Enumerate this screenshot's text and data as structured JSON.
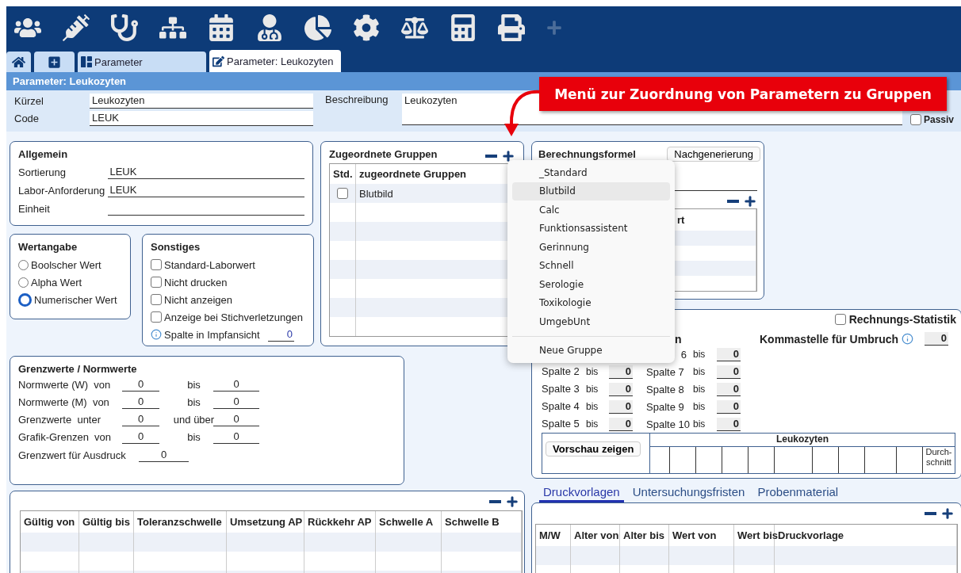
{
  "tabs": [
    {
      "label": "Parameter",
      "kind": "list",
      "selected": false
    },
    {
      "label": "Parameter: Leukozyten",
      "kind": "edit",
      "selected": true
    }
  ],
  "page_title": "Parameter: Leukozyten",
  "header_form": {
    "kuerzel": {
      "label": "Kürzel",
      "value": "Leukozyten"
    },
    "code": {
      "label": "Code",
      "value": "LEUK"
    },
    "beschreibung": {
      "label": "Beschreibung",
      "value": "Leukozyten"
    },
    "passiv": {
      "label": "Passiv",
      "checked": false
    }
  },
  "callout": {
    "text": "Menü zur Zuordnung von Parametern zu Gruppen"
  },
  "allgemein": {
    "title": "Allgemein",
    "fields": [
      {
        "label": "Sortierung",
        "value": "LEUK"
      },
      {
        "label": "Labor-Anforderung",
        "value": "LEUK"
      },
      {
        "label": "Einheit"
      }
    ]
  },
  "wertangabe": {
    "title": "Wertangabe",
    "options": [
      {
        "label": "Boolscher Wert",
        "selected": false
      },
      {
        "label": "Alpha Wert",
        "selected": false
      },
      {
        "label": "Numerischer Wert",
        "selected": true
      }
    ]
  },
  "sonstiges": {
    "title": "Sonstiges",
    "checkboxes": [
      {
        "label": "Standard-Laborwert",
        "checked": false
      },
      {
        "label": "Nicht drucken",
        "checked": false
      },
      {
        "label": "Nicht anzeigen",
        "checked": false
      },
      {
        "label": "Anzeige bei Stichverletzungen",
        "checked": false
      }
    ],
    "impf": {
      "label": "Spalte in Impfansicht",
      "value": "0"
    }
  },
  "gruppen": {
    "title": "Zugeordnete Gruppen",
    "columns": [
      "Std.",
      "zugeordnete Gruppen"
    ],
    "rows": [
      {
        "std": false,
        "name": "Blutbild"
      }
    ]
  },
  "menu": {
    "items": [
      {
        "label": "_Standard",
        "selected": false
      },
      {
        "label": "Blutbild",
        "selected": true
      },
      {
        "label": "Calc",
        "selected": false
      },
      {
        "label": "Funktionsassistent",
        "selected": false
      },
      {
        "label": "Gerinnung",
        "selected": false
      },
      {
        "label": "Schnell",
        "selected": false
      },
      {
        "label": "Serologie",
        "selected": false
      },
      {
        "label": "Toxikologie",
        "selected": false
      },
      {
        "label": "UmgebUnt",
        "selected": false
      }
    ],
    "footer": "Neue Gruppe"
  },
  "formel": {
    "title": "Berechnungsformel",
    "button": "Nachgenerierung",
    "list_header": "rt"
  },
  "statistik": {
    "heading": "n",
    "checkbox": {
      "label": "Rechnungs-Statistik",
      "checked": false
    },
    "komma": {
      "label": "Kommastelle für Umbruch",
      "value": "0"
    },
    "left": [
      {
        "label": "Spalte 2",
        "bis": "bis",
        "value": "0"
      },
      {
        "label": "Spalte 3",
        "bis": "bis",
        "value": "0"
      },
      {
        "label": "Spalte 4",
        "bis": "bis",
        "value": "0"
      },
      {
        "label": "Spalte 5",
        "bis": "bis",
        "value": "0"
      }
    ],
    "right": [
      {
        "label": "6",
        "bis": "bis",
        "value": "0"
      },
      {
        "label": "Spalte 7",
        "bis": "bis",
        "value": "0"
      },
      {
        "label": "Spalte 8",
        "bis": "bis",
        "value": "0"
      },
      {
        "label": "Spalte 9",
        "bis": "bis",
        "value": "0"
      },
      {
        "label": "Spalte 10",
        "bis": "bis",
        "value": "0"
      }
    ],
    "preview_button": "Vorschau zeigen",
    "preview_title": "Leukozyten",
    "preview_last": "Durch-schnitt"
  },
  "grenzwerte": {
    "title": "Grenzwerte / Normwerte",
    "rows": [
      {
        "label": "Normwerte (W)  von",
        "v1": "0",
        "op": "bis",
        "v2": "0"
      },
      {
        "label": "Normwerte (M)  von",
        "v1": "0",
        "op": "bis",
        "v2": "0"
      },
      {
        "label": "Grenzwerte  unter",
        "v1": "0",
        "op": "und über",
        "v2": "0"
      },
      {
        "label": "Grafik-Grenzen  von",
        "v1": "0",
        "op": "bis",
        "v2": "0"
      }
    ],
    "ausdruck": {
      "label": "Grenzwert für Ausdruck",
      "value": "0"
    }
  },
  "gueltig_table": {
    "columns": [
      "Gültig von",
      "Gültig bis",
      "Toleranzschwelle",
      "Umsetzung AP",
      "Rückkehr AP",
      "Schwelle A",
      "Schwelle B"
    ]
  },
  "lower_tabs": [
    {
      "label": "Druckvorlagen",
      "selected": true
    },
    {
      "label": "Untersuchungsfristen",
      "selected": false
    },
    {
      "label": "Probenmaterial",
      "selected": false
    }
  ],
  "druck_table": {
    "columns": [
      "M/W",
      "Alter von",
      "Alter bis",
      "Wert von",
      "Wert bis",
      "Druckvorlage"
    ]
  }
}
